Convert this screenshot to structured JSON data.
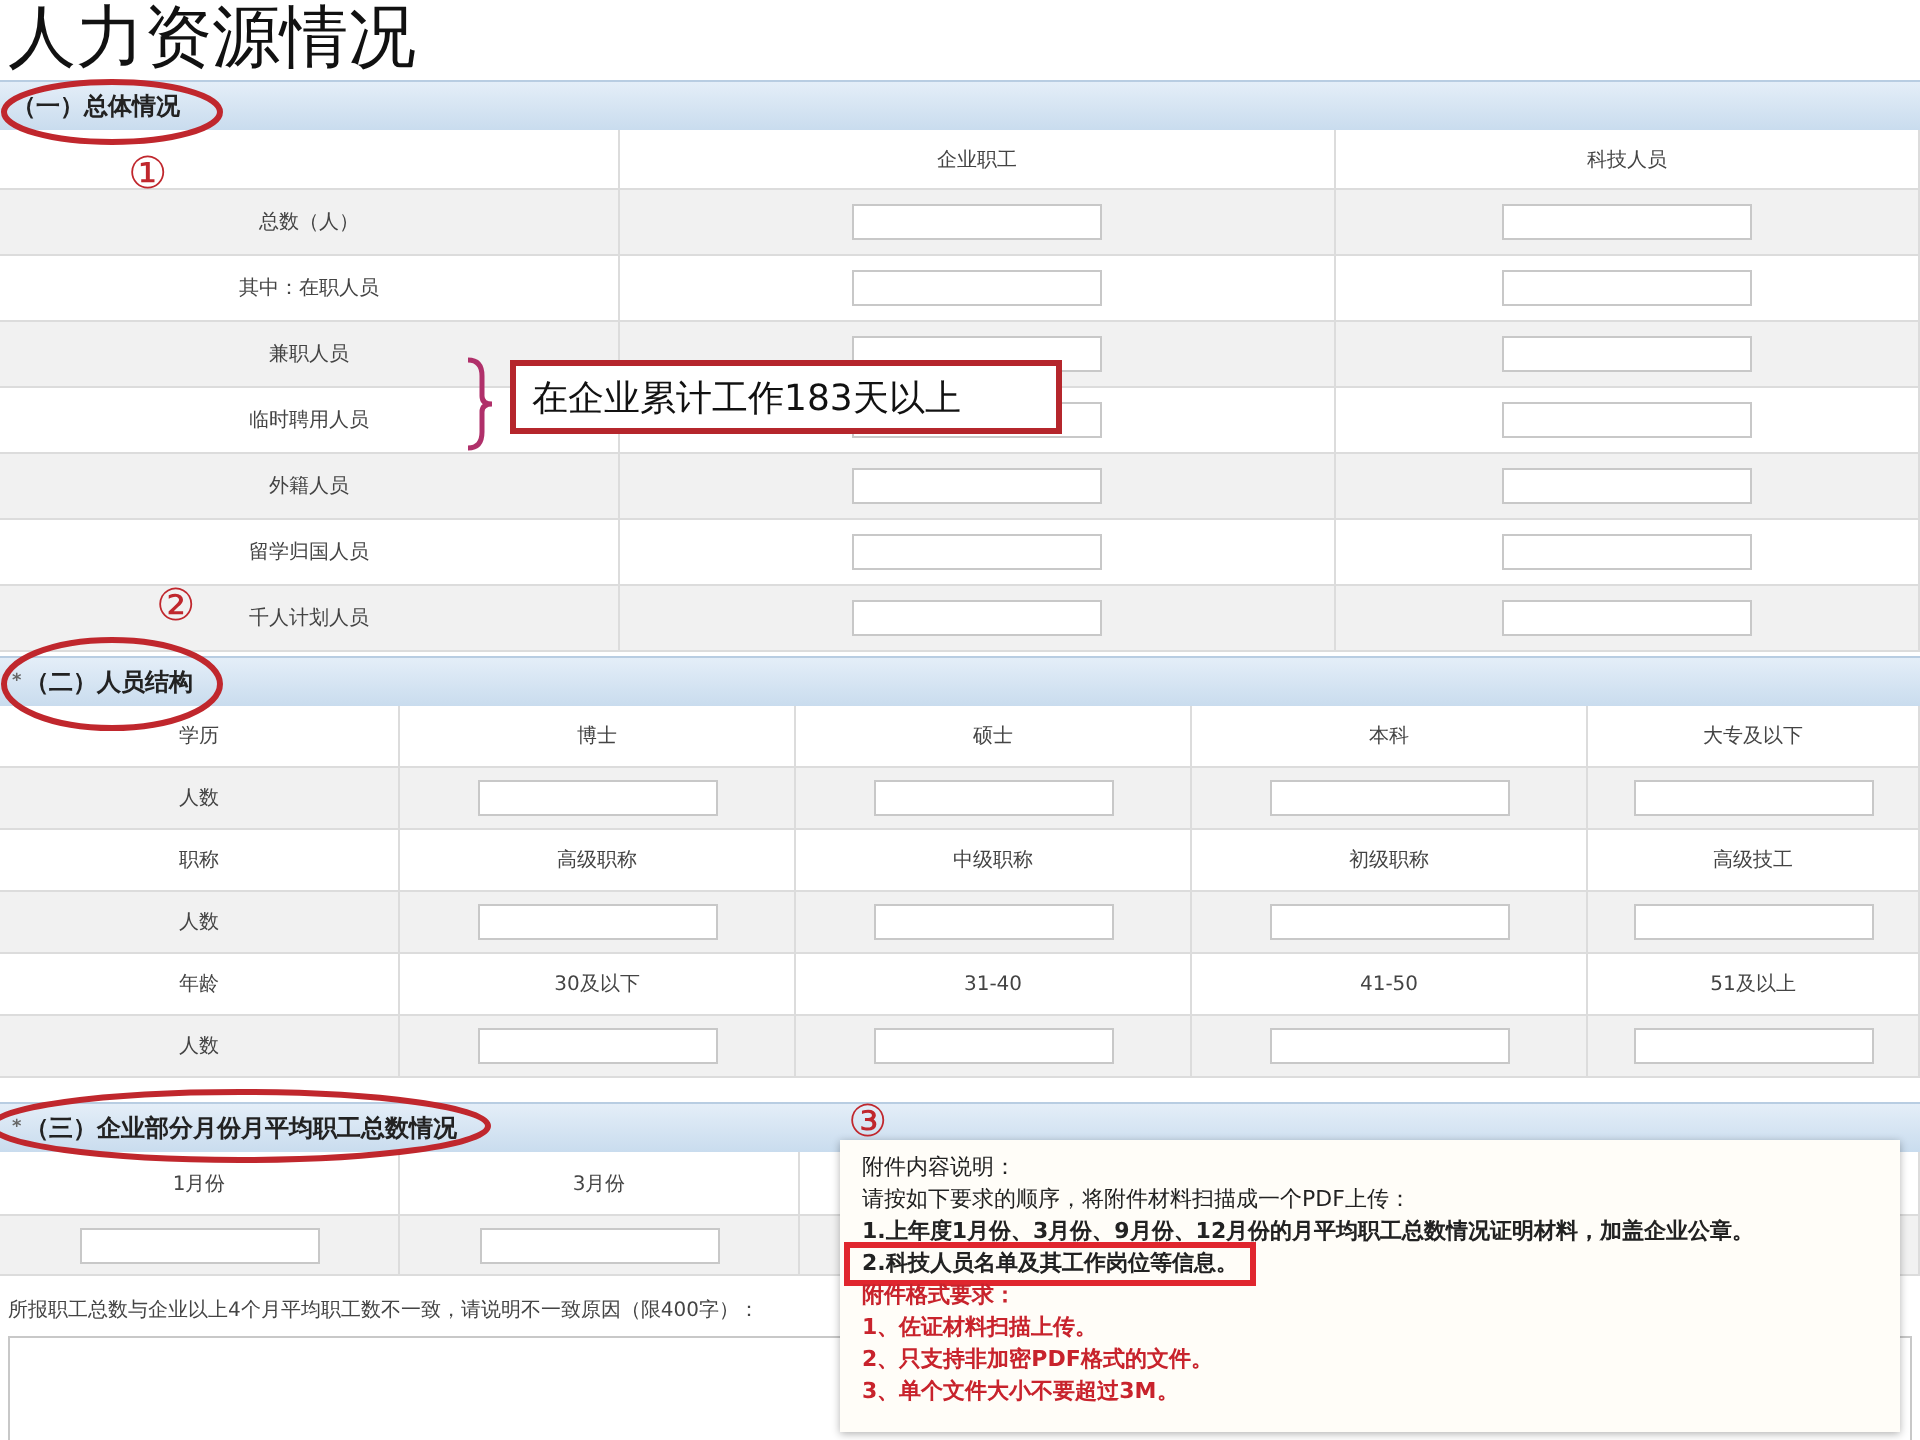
{
  "title": "人力资源情况",
  "overview": {
    "heading": "（一）总体情况",
    "columns": [
      "企业职工",
      "科技人员"
    ],
    "rows": [
      {
        "label": "总数（人）"
      },
      {
        "label": "其中：在职人员"
      },
      {
        "label": "兼职人员"
      },
      {
        "label": "临时聘用人员"
      },
      {
        "label": "外籍人员"
      },
      {
        "label": "留学归国人员"
      },
      {
        "label": "千人计划人员"
      }
    ]
  },
  "structure": {
    "marker": "*",
    "heading": "（二）人员结构",
    "rows": [
      {
        "kind": "labels",
        "label": "学历",
        "cells": [
          "博士",
          "硕士",
          "本科",
          "大专及以下"
        ]
      },
      {
        "kind": "inputs",
        "label": "人数"
      },
      {
        "kind": "labels",
        "label": "职称",
        "cells": [
          "高级职称",
          "中级职称",
          "初级职称",
          "高级技工"
        ]
      },
      {
        "kind": "inputs",
        "label": "人数"
      },
      {
        "kind": "labels",
        "label": "年龄",
        "cells": [
          "30及以下",
          "31-40",
          "41-50",
          "51及以上"
        ]
      },
      {
        "kind": "inputs",
        "label": "人数"
      }
    ]
  },
  "monthly": {
    "marker": "*",
    "heading": "（三）企业部分月份月平均职工总数情况",
    "months": [
      "1月份",
      "3月份"
    ],
    "note": "所报职工总数与企业以上4个月平均职工数不一致，请说明不一致原因（限400字）："
  },
  "popup": {
    "lines": [
      {
        "kind": "plain",
        "text": "附件内容说明："
      },
      {
        "kind": "plain",
        "text": "请按如下要求的顺序，将附件材料扫描成一个PDF上传："
      },
      {
        "kind": "bold",
        "text": "1.上年度1月份、3月份、9月份、12月份的月平均职工总数情况证明材料，加盖企业公章。"
      },
      {
        "kind": "bold",
        "text": "2.科技人员名单及其工作岗位等信息。",
        "boxed": true
      },
      {
        "kind": "red",
        "text": "附件格式要求："
      },
      {
        "kind": "red",
        "text": "1、佐证材料扫描上传。"
      },
      {
        "kind": "red",
        "text": "2、只支持非加密PDF格式的文件。"
      },
      {
        "kind": "red",
        "text": "3、单个文件大小不要超过3M。"
      }
    ]
  },
  "annotations": {
    "numbers": [
      "①",
      "②",
      "③"
    ],
    "callout": "在企业累计工作183天以上"
  }
}
